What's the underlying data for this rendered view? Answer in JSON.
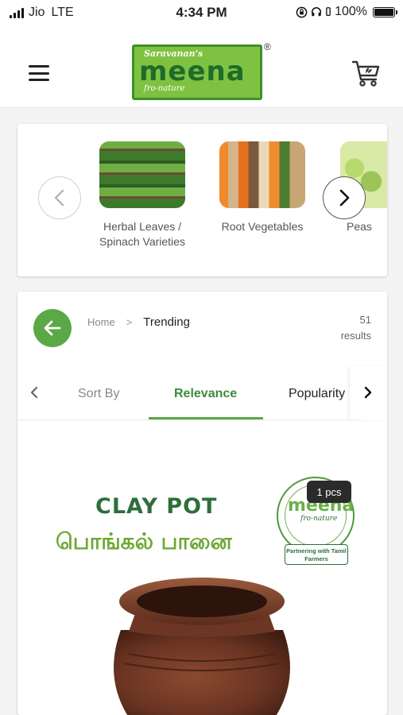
{
  "status_bar": {
    "carrier": "Jio",
    "network": "LTE",
    "time": "4:34 PM",
    "battery": "100%"
  },
  "header": {
    "logo_top": "Saravanan's",
    "logo_main": "meena",
    "logo_sub": "fro-nature",
    "logo_reg": "®"
  },
  "categories": {
    "items": [
      {
        "label": "Herbal Leaves / Spinach Varieties"
      },
      {
        "label": "Root Vegetables"
      },
      {
        "label": "Peas"
      }
    ]
  },
  "listing": {
    "breadcrumb": {
      "home": "Home",
      "separator": ">",
      "current": "Trending"
    },
    "results_count": "51",
    "results_label": "results",
    "sort": {
      "label": "Sort By",
      "options": [
        "Relevance",
        "Popularity"
      ],
      "selected": "Relevance"
    }
  },
  "product": {
    "title_en": "CLAY POT",
    "title_ta": "பொங்கல் பானை",
    "quantity": "1 pcs",
    "seal": {
      "word": "meena",
      "sub": "fro-nature",
      "banner": "Partnering with Tamil Farmers"
    }
  },
  "colors": {
    "accent": "#5ba846",
    "accent_dark": "#3d8a3a",
    "title_green": "#2e6e3a"
  }
}
